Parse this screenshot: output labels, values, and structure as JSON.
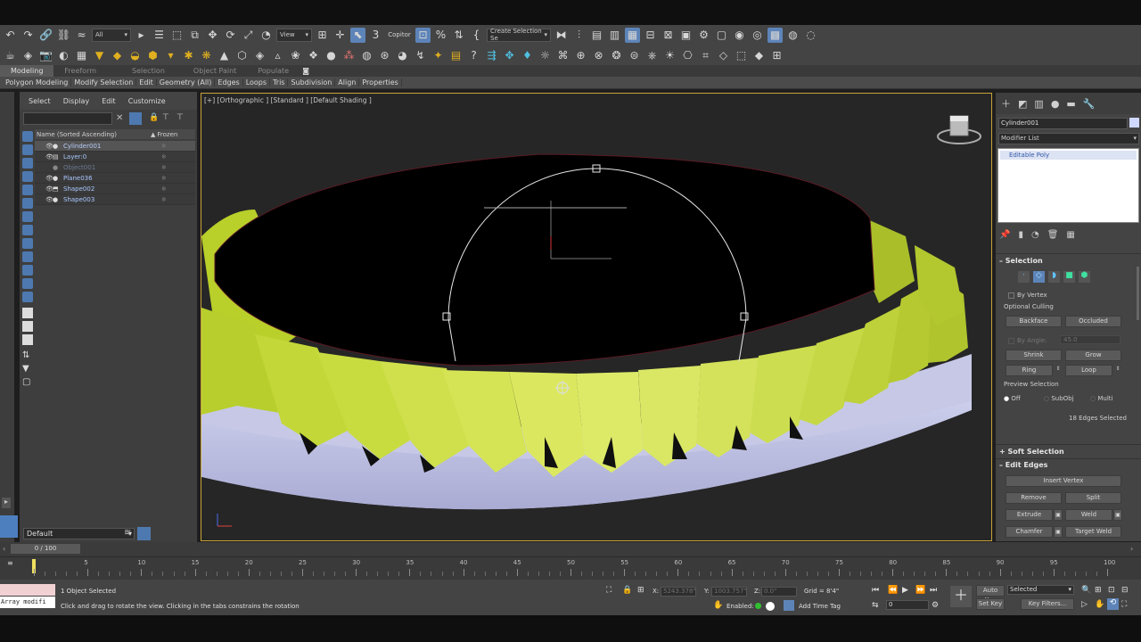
{
  "toolbar": {
    "selection_filter": "All",
    "reference_coord": "View",
    "copitor_label": "Copitor",
    "named_selection": "Create Selection Se"
  },
  "ribbon": {
    "tabs": [
      "Modeling",
      "Freeform",
      "Selection",
      "Object Paint",
      "Populate"
    ],
    "subtabs": [
      "Polygon Modeling",
      "Modify Selection",
      "Edit",
      "Geometry (All)",
      "Edges",
      "Loops",
      "Tris",
      "Subdivision",
      "Align",
      "Properties"
    ]
  },
  "scene_explorer": {
    "menu": [
      "Select",
      "Display",
      "Edit",
      "Customize"
    ],
    "column_name": "Name (Sorted Ascending)",
    "column_frozen": "Frozen",
    "rows": [
      {
        "name": "Cylinder001"
      },
      {
        "name": "Layer:0"
      },
      {
        "name": "Object001"
      },
      {
        "name": "Plane036"
      },
      {
        "name": "Shape002"
      },
      {
        "name": "Shape003"
      }
    ],
    "layer_dropdown": "Default"
  },
  "viewport": {
    "label": "[+] [Orthographic ] [Standard ] [Default Shading ]"
  },
  "command_panel": {
    "object_name": "Cylinder001",
    "modifier_list": "Modifier List",
    "stack_item": "Editable Poly",
    "selection": {
      "title": "Selection",
      "by_vertex": "By Vertex",
      "optional_culling": "Optional Culling",
      "backface": "Backface",
      "occluded": "Occluded",
      "by_angle": "By Angle:",
      "angle_value": "45.0",
      "shrink": "Shrink",
      "grow": "Grow",
      "ring": "Ring",
      "loop": "Loop",
      "preview_selection": "Preview Selection",
      "off": "Off",
      "subobj": "SubObj",
      "multi": "Multi",
      "edges_selected": "18 Edges Selected"
    },
    "soft_selection": "Soft Selection",
    "edit_edges": {
      "title": "Edit Edges",
      "insert_vertex": "Insert Vertex",
      "remove": "Remove",
      "split": "Split",
      "extrude": "Extrude",
      "weld": "Weld",
      "chamfer": "Chamfer",
      "target_weld": "Target Weld"
    }
  },
  "timeline": {
    "slider": "0 / 100",
    "ticks": [
      "5",
      "10",
      "15",
      "20",
      "25",
      "30",
      "35",
      "40",
      "45",
      "50",
      "55",
      "60",
      "65",
      "70",
      "75",
      "80",
      "85",
      "90",
      "95",
      "100"
    ]
  },
  "status": {
    "maxscript_text": "Array modifi",
    "selected": "1 Object Selected",
    "prompt": "Click and drag to rotate the view.  Clicking in the tabs constrains the rotation",
    "x_label": "X:",
    "x_value": "5243.378\"",
    "y_label": "Y:",
    "y_value": "1003.757\"",
    "z_label": "Z:",
    "z_value": "0.0\"",
    "grid": "Grid = 8'4\"",
    "enabled": "Enabled:",
    "add_time_tag": "Add Time Tag",
    "auto_key": "Auto Key",
    "set_key": "Set Key",
    "key_mode": "Selected",
    "key_filters": "Key Filters...",
    "frame": "0"
  }
}
